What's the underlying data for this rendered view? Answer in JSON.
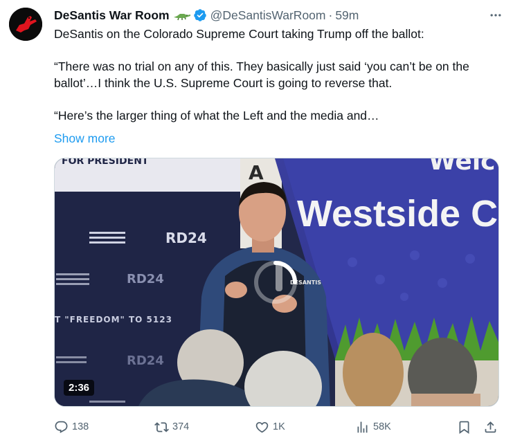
{
  "author": {
    "display_name": "DeSantis War Room",
    "handle": "@DeSantisWarRoom",
    "separator": "·",
    "time": "59m",
    "verified": true
  },
  "tweet": {
    "line1": "DeSantis on the Colorado Supreme Court taking Trump off the ballot:",
    "line2": "“There was no trial on any of this. They basically just said ‘you can’t be on the ballot’…I think the U.S. Supreme Court is going to reverse that.",
    "line3": "“Here’s the larger thing of what the Left and the media and…",
    "show_more": "Show more"
  },
  "video": {
    "duration": "2:36",
    "banner_text": "Westside Con",
    "banner_top_text": "Welc",
    "backdrop_top_text": "FOR PRESIDENT",
    "backdrop_logo_text": "RD24",
    "backdrop_slogan": "T \"FREEDOM\" TO 5123",
    "vest_text": "DESANTIS",
    "sign_letter": "A"
  },
  "actions": {
    "replies": "138",
    "reposts": "374",
    "likes": "1K",
    "views": "58K"
  },
  "colors": {
    "text_primary": "#0f1419",
    "text_secondary": "#536471",
    "link": "#1d9bf0",
    "verified": "#1d9bf0"
  }
}
